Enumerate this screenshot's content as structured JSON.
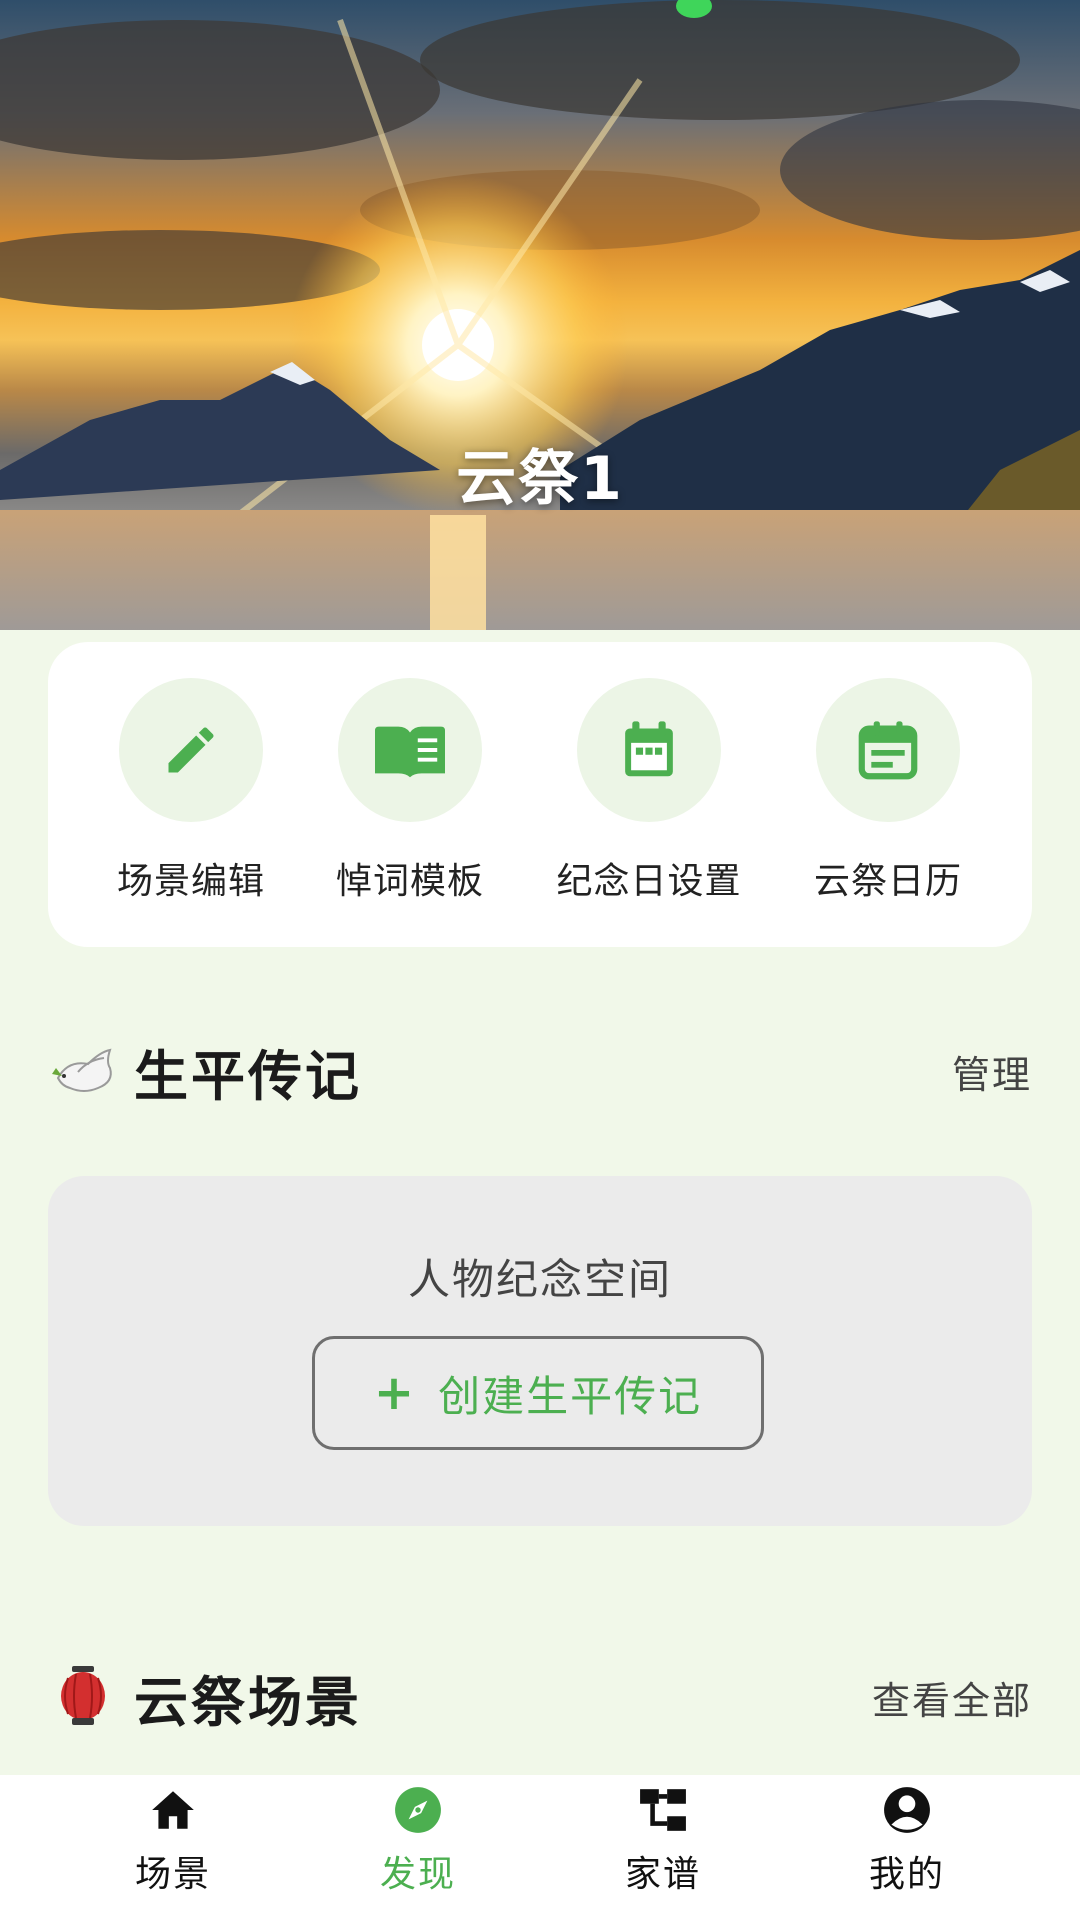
{
  "hero": {
    "title": "云祭1"
  },
  "quick_actions": [
    {
      "label": "场景编辑",
      "icon": "pencil-icon"
    },
    {
      "label": "悼词模板",
      "icon": "book-icon"
    },
    {
      "label": "纪念日设置",
      "icon": "calendar-icon"
    },
    {
      "label": "云祭日历",
      "icon": "calendar-list-icon"
    }
  ],
  "biography": {
    "emoji": "dove-emoji",
    "title": "生平传记",
    "manage_label": "管理",
    "card_caption": "人物纪念空间",
    "create_plus": "+",
    "create_label": "创建生平传记"
  },
  "scenes": {
    "emoji": "lantern-emoji",
    "title": "云祭场景",
    "view_all_label": "查看全部"
  },
  "bottom_nav": [
    {
      "label": "场景",
      "icon": "home-icon",
      "active": false
    },
    {
      "label": "发现",
      "icon": "compass-icon",
      "active": true
    },
    {
      "label": "家谱",
      "icon": "family-tree-icon",
      "active": false
    },
    {
      "label": "我的",
      "icon": "profile-icon",
      "active": false
    }
  ],
  "colors": {
    "accent": "#4caf50",
    "page_background": "#f1f8e9",
    "icon_circle": "#ecf5e6",
    "card_gray": "#ebebeb"
  }
}
